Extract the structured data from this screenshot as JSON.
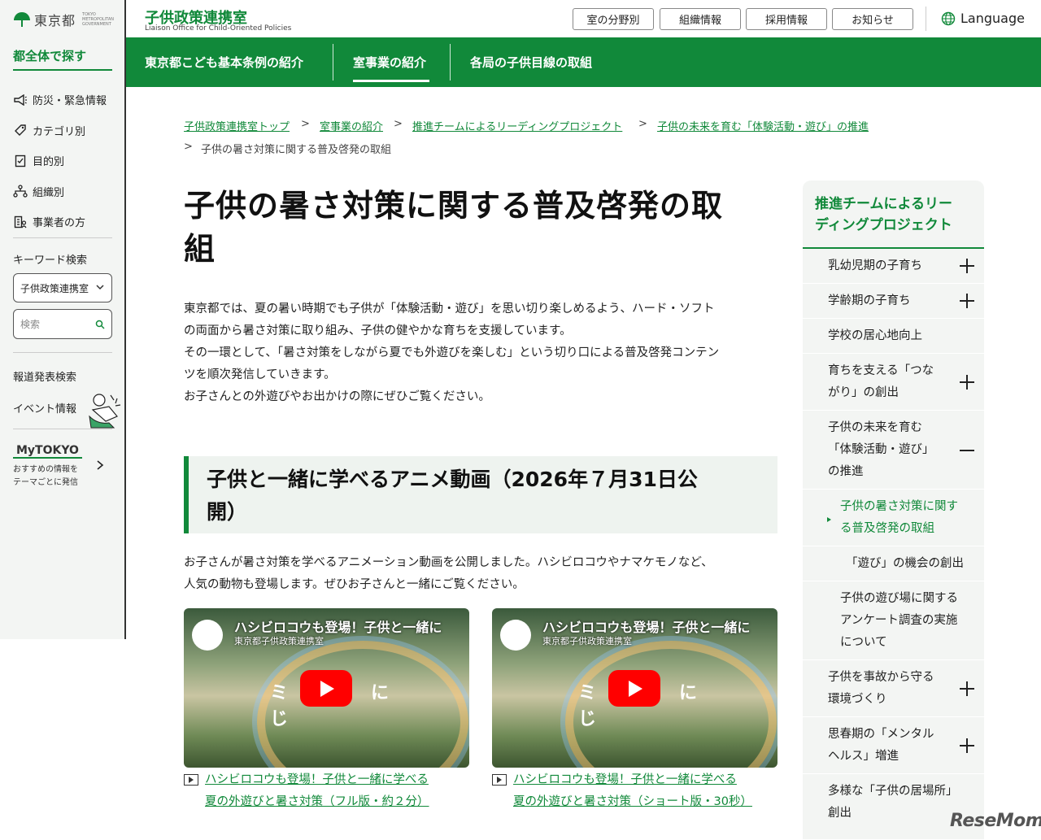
{
  "colors": {
    "brand_green": "#11893a",
    "sidebar_bg": "#f3f5f3"
  },
  "left": {
    "logo_name": "東京都",
    "logo_en": "TOKYO METROPOLITAN GOVERNMENT",
    "search_all": "都全体で探す",
    "nav": [
      {
        "label": "防災・緊急情報",
        "icon": "megaphone-icon"
      },
      {
        "label": "カテゴリ別",
        "icon": "tag-icon"
      },
      {
        "label": "目的別",
        "icon": "checklist-icon"
      },
      {
        "label": "組織別",
        "icon": "org-chart-icon"
      },
      {
        "label": "事業者の方",
        "icon": "business-icon"
      }
    ],
    "keyword_title": "キーワード検索",
    "keyword_select": "子供政策連携室",
    "search_placeholder": "検索",
    "press_search": "報道発表検索",
    "event_info": "イベント情報",
    "mytokyo_logo": "MyTOKYO",
    "mytokyo_desc1": "おすすめの情報を",
    "mytokyo_desc2": "テーマごとに発信"
  },
  "header": {
    "title": "子供政策連携室",
    "subtitle": "Liaison Office for Child-Oriented Policies",
    "buttons": [
      "室の分野別",
      "組織情報",
      "採用情報",
      "お知らせ"
    ],
    "language": "Language"
  },
  "gnav": [
    "東京都こども基本条例の紹介",
    "室事業の紹介",
    "各局の子供目線の取組"
  ],
  "breadcrumb": {
    "links": [
      "子供政策連携室トップ",
      "室事業の紹介",
      "推進チームによるリーディングプロジェクト",
      "子供の未来を育む「体験活動・遊び」の推進"
    ],
    "current": "子供の暑さ対策に関する普及啓発の取組"
  },
  "main": {
    "title_l1": "子供の暑さ対策に関する普及啓発の取",
    "title_l2": "組",
    "intro": [
      "東京都では、夏の暑い時期でも子供が「体験活動・遊び」を思い切り楽しめるよう、ハード・ソフト",
      "の両面から暑さ対策に取り組み、子供の健やかな育ちを支援しています。",
      "その一環として、「暑さ対策をしながら夏でも外遊びを楽しむ」という切り口による普及啓発コンテン",
      "ツを順次発信していきます。",
      "お子さんとの外遊びやお出かけの際にぜひご覧ください。"
    ],
    "h2_l1": "子供と一緒に学べるアニメ動画（2026年７月31日公",
    "h2_l2": "開）",
    "para2": [
      "お子さんが暑さ対策を学べるアニメーション動画を公開しました。ハシビロコウやナマケモノなど、",
      "人気の動物も登場します。ぜひお子さんと一緒にご覧ください。"
    ],
    "videos": [
      {
        "title": "ハシビロコウも登場！子供と一緒に",
        "channel": "東京都子供政策連携室",
        "overlay": "ミズにじ",
        "link_l1": "ハシビロコウも登場！子供と一緒に学べる",
        "link_l2": "夏の外遊びと暑さ対策（フル版・約２分）"
      },
      {
        "title": "ハシビロコウも登場！子供と一緒に",
        "channel": "東京都子供政策連携室",
        "overlay": "ミズにじ",
        "link_l1": "ハシビロコウも登場！子供と一緒に学べる",
        "link_l2": "夏の外遊びと暑さ対策（ショート版・30秒）"
      }
    ]
  },
  "sidenav": {
    "heading_l1": "推進チームによるリー",
    "heading_l2": "ディングプロジェクト",
    "items": [
      {
        "l1": "乳幼児期の子育ち",
        "l2": "",
        "l3": "",
        "toggle": "plus"
      },
      {
        "l1": "学齢期の子育ち",
        "l2": "",
        "l3": "",
        "toggle": "plus"
      },
      {
        "l1": "学校の居心地向上",
        "l2": "",
        "l3": "",
        "toggle": ""
      },
      {
        "l1": "育ちを支える「つな",
        "l2": "がり」の創出",
        "l3": "",
        "toggle": "plus"
      },
      {
        "l1": "子供の未来を育む",
        "l2": "「体験活動・遊び」",
        "l3": "の推進",
        "toggle": "minus"
      },
      {
        "l1": "子供の暑さ対策に関す",
        "l2": "る普及啓発の取組",
        "l3": "",
        "toggle": ""
      },
      {
        "l1": "「遊び」の機会の創出",
        "l2": "",
        "l3": "",
        "toggle": ""
      },
      {
        "l1": "子供の遊び場に関する",
        "l2": "アンケート調査の実施",
        "l3": "について",
        "toggle": ""
      },
      {
        "l1": "子供を事故から守る",
        "l2": "環境づくり",
        "l3": "",
        "toggle": "plus"
      },
      {
        "l1": "思春期の「メンタル",
        "l2": "ヘルス」増進",
        "l3": "",
        "toggle": "plus"
      },
      {
        "l1": "多様な「子供の居場所」",
        "l2": "創出",
        "l3": "",
        "toggle": ""
      }
    ]
  },
  "watermark": "ReseMom"
}
